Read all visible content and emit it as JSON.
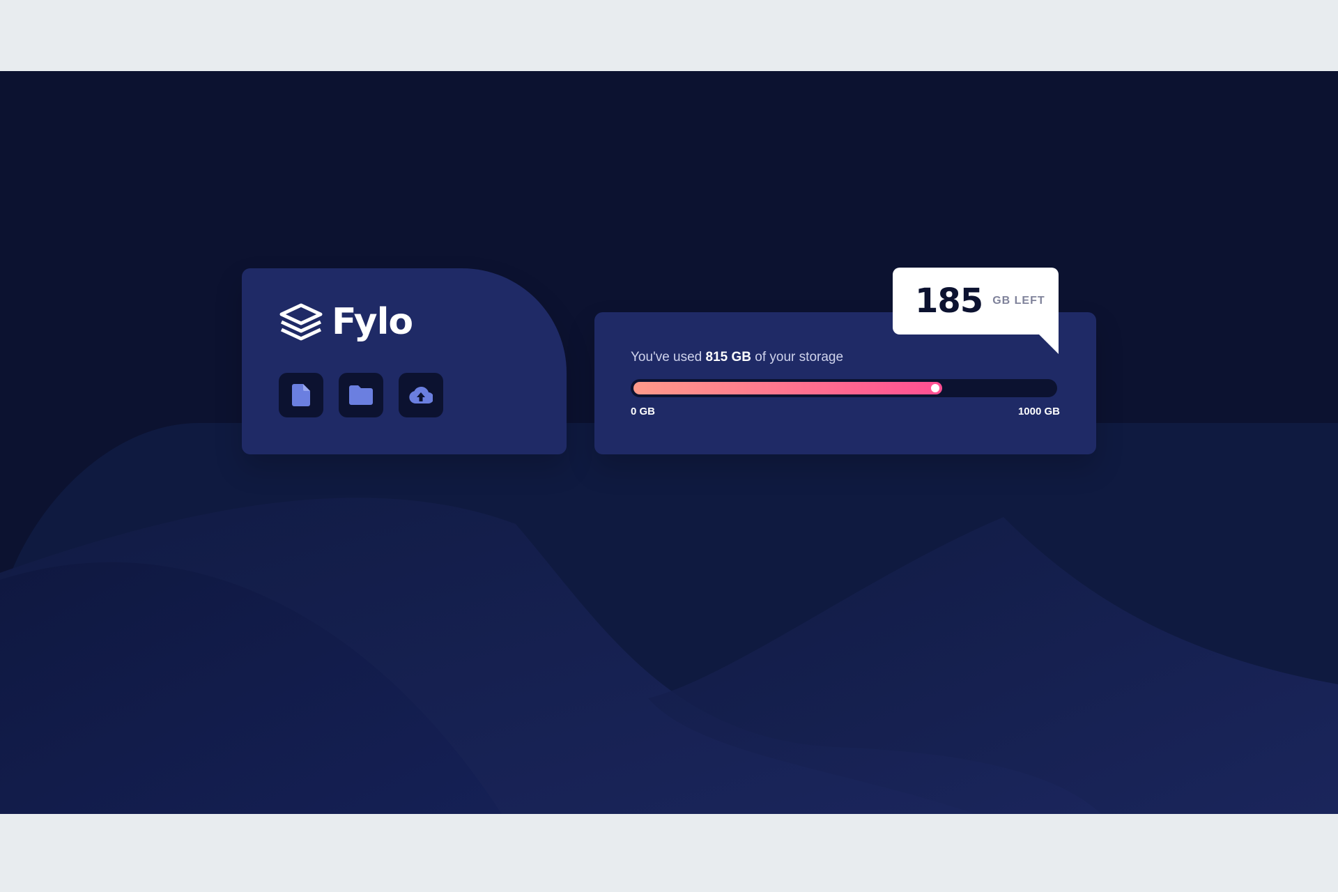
{
  "brand": {
    "name": "Fylo"
  },
  "toolbar": {
    "icons": [
      "document-icon",
      "folder-icon",
      "upload-icon"
    ]
  },
  "storage": {
    "usage_prefix": "You've used",
    "used_amount": "815 GB",
    "usage_suffix": "of your storage",
    "min_label": "0 GB",
    "max_label": "1000 GB",
    "used_fraction": 0.815,
    "remaining_value": "185",
    "remaining_unit": "GB LEFT"
  },
  "colors": {
    "page_background": "#e8ecef",
    "app_background": "#0c1230",
    "card_background": "#1f2a66",
    "icon_color": "#6b7fe0",
    "gradient_start": "#ff9a8a",
    "gradient_end": "#ff4f93"
  }
}
